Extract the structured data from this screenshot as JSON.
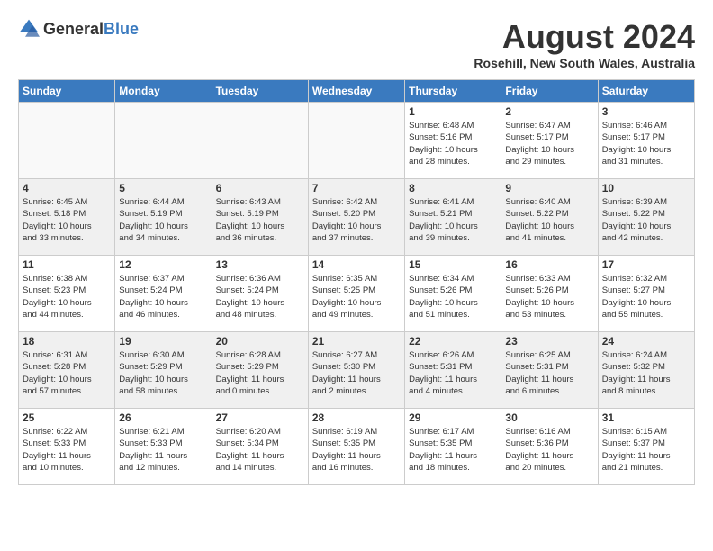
{
  "header": {
    "logo_general": "General",
    "logo_blue": "Blue",
    "month_year": "August 2024",
    "location": "Rosehill, New South Wales, Australia"
  },
  "weekdays": [
    "Sunday",
    "Monday",
    "Tuesday",
    "Wednesday",
    "Thursday",
    "Friday",
    "Saturday"
  ],
  "weeks": [
    [
      {
        "day": "",
        "info": "",
        "empty": true
      },
      {
        "day": "",
        "info": "",
        "empty": true
      },
      {
        "day": "",
        "info": "",
        "empty": true
      },
      {
        "day": "",
        "info": "",
        "empty": true
      },
      {
        "day": "1",
        "info": "Sunrise: 6:48 AM\nSunset: 5:16 PM\nDaylight: 10 hours\nand 28 minutes."
      },
      {
        "day": "2",
        "info": "Sunrise: 6:47 AM\nSunset: 5:17 PM\nDaylight: 10 hours\nand 29 minutes."
      },
      {
        "day": "3",
        "info": "Sunrise: 6:46 AM\nSunset: 5:17 PM\nDaylight: 10 hours\nand 31 minutes."
      }
    ],
    [
      {
        "day": "4",
        "info": "Sunrise: 6:45 AM\nSunset: 5:18 PM\nDaylight: 10 hours\nand 33 minutes."
      },
      {
        "day": "5",
        "info": "Sunrise: 6:44 AM\nSunset: 5:19 PM\nDaylight: 10 hours\nand 34 minutes."
      },
      {
        "day": "6",
        "info": "Sunrise: 6:43 AM\nSunset: 5:19 PM\nDaylight: 10 hours\nand 36 minutes."
      },
      {
        "day": "7",
        "info": "Sunrise: 6:42 AM\nSunset: 5:20 PM\nDaylight: 10 hours\nand 37 minutes."
      },
      {
        "day": "8",
        "info": "Sunrise: 6:41 AM\nSunset: 5:21 PM\nDaylight: 10 hours\nand 39 minutes."
      },
      {
        "day": "9",
        "info": "Sunrise: 6:40 AM\nSunset: 5:22 PM\nDaylight: 10 hours\nand 41 minutes."
      },
      {
        "day": "10",
        "info": "Sunrise: 6:39 AM\nSunset: 5:22 PM\nDaylight: 10 hours\nand 42 minutes."
      }
    ],
    [
      {
        "day": "11",
        "info": "Sunrise: 6:38 AM\nSunset: 5:23 PM\nDaylight: 10 hours\nand 44 minutes."
      },
      {
        "day": "12",
        "info": "Sunrise: 6:37 AM\nSunset: 5:24 PM\nDaylight: 10 hours\nand 46 minutes."
      },
      {
        "day": "13",
        "info": "Sunrise: 6:36 AM\nSunset: 5:24 PM\nDaylight: 10 hours\nand 48 minutes."
      },
      {
        "day": "14",
        "info": "Sunrise: 6:35 AM\nSunset: 5:25 PM\nDaylight: 10 hours\nand 49 minutes."
      },
      {
        "day": "15",
        "info": "Sunrise: 6:34 AM\nSunset: 5:26 PM\nDaylight: 10 hours\nand 51 minutes."
      },
      {
        "day": "16",
        "info": "Sunrise: 6:33 AM\nSunset: 5:26 PM\nDaylight: 10 hours\nand 53 minutes."
      },
      {
        "day": "17",
        "info": "Sunrise: 6:32 AM\nSunset: 5:27 PM\nDaylight: 10 hours\nand 55 minutes."
      }
    ],
    [
      {
        "day": "18",
        "info": "Sunrise: 6:31 AM\nSunset: 5:28 PM\nDaylight: 10 hours\nand 57 minutes."
      },
      {
        "day": "19",
        "info": "Sunrise: 6:30 AM\nSunset: 5:29 PM\nDaylight: 10 hours\nand 58 minutes."
      },
      {
        "day": "20",
        "info": "Sunrise: 6:28 AM\nSunset: 5:29 PM\nDaylight: 11 hours\nand 0 minutes."
      },
      {
        "day": "21",
        "info": "Sunrise: 6:27 AM\nSunset: 5:30 PM\nDaylight: 11 hours\nand 2 minutes."
      },
      {
        "day": "22",
        "info": "Sunrise: 6:26 AM\nSunset: 5:31 PM\nDaylight: 11 hours\nand 4 minutes."
      },
      {
        "day": "23",
        "info": "Sunrise: 6:25 AM\nSunset: 5:31 PM\nDaylight: 11 hours\nand 6 minutes."
      },
      {
        "day": "24",
        "info": "Sunrise: 6:24 AM\nSunset: 5:32 PM\nDaylight: 11 hours\nand 8 minutes."
      }
    ],
    [
      {
        "day": "25",
        "info": "Sunrise: 6:22 AM\nSunset: 5:33 PM\nDaylight: 11 hours\nand 10 minutes."
      },
      {
        "day": "26",
        "info": "Sunrise: 6:21 AM\nSunset: 5:33 PM\nDaylight: 11 hours\nand 12 minutes."
      },
      {
        "day": "27",
        "info": "Sunrise: 6:20 AM\nSunset: 5:34 PM\nDaylight: 11 hours\nand 14 minutes."
      },
      {
        "day": "28",
        "info": "Sunrise: 6:19 AM\nSunset: 5:35 PM\nDaylight: 11 hours\nand 16 minutes."
      },
      {
        "day": "29",
        "info": "Sunrise: 6:17 AM\nSunset: 5:35 PM\nDaylight: 11 hours\nand 18 minutes."
      },
      {
        "day": "30",
        "info": "Sunrise: 6:16 AM\nSunset: 5:36 PM\nDaylight: 11 hours\nand 20 minutes."
      },
      {
        "day": "31",
        "info": "Sunrise: 6:15 AM\nSunset: 5:37 PM\nDaylight: 11 hours\nand 21 minutes."
      }
    ]
  ]
}
